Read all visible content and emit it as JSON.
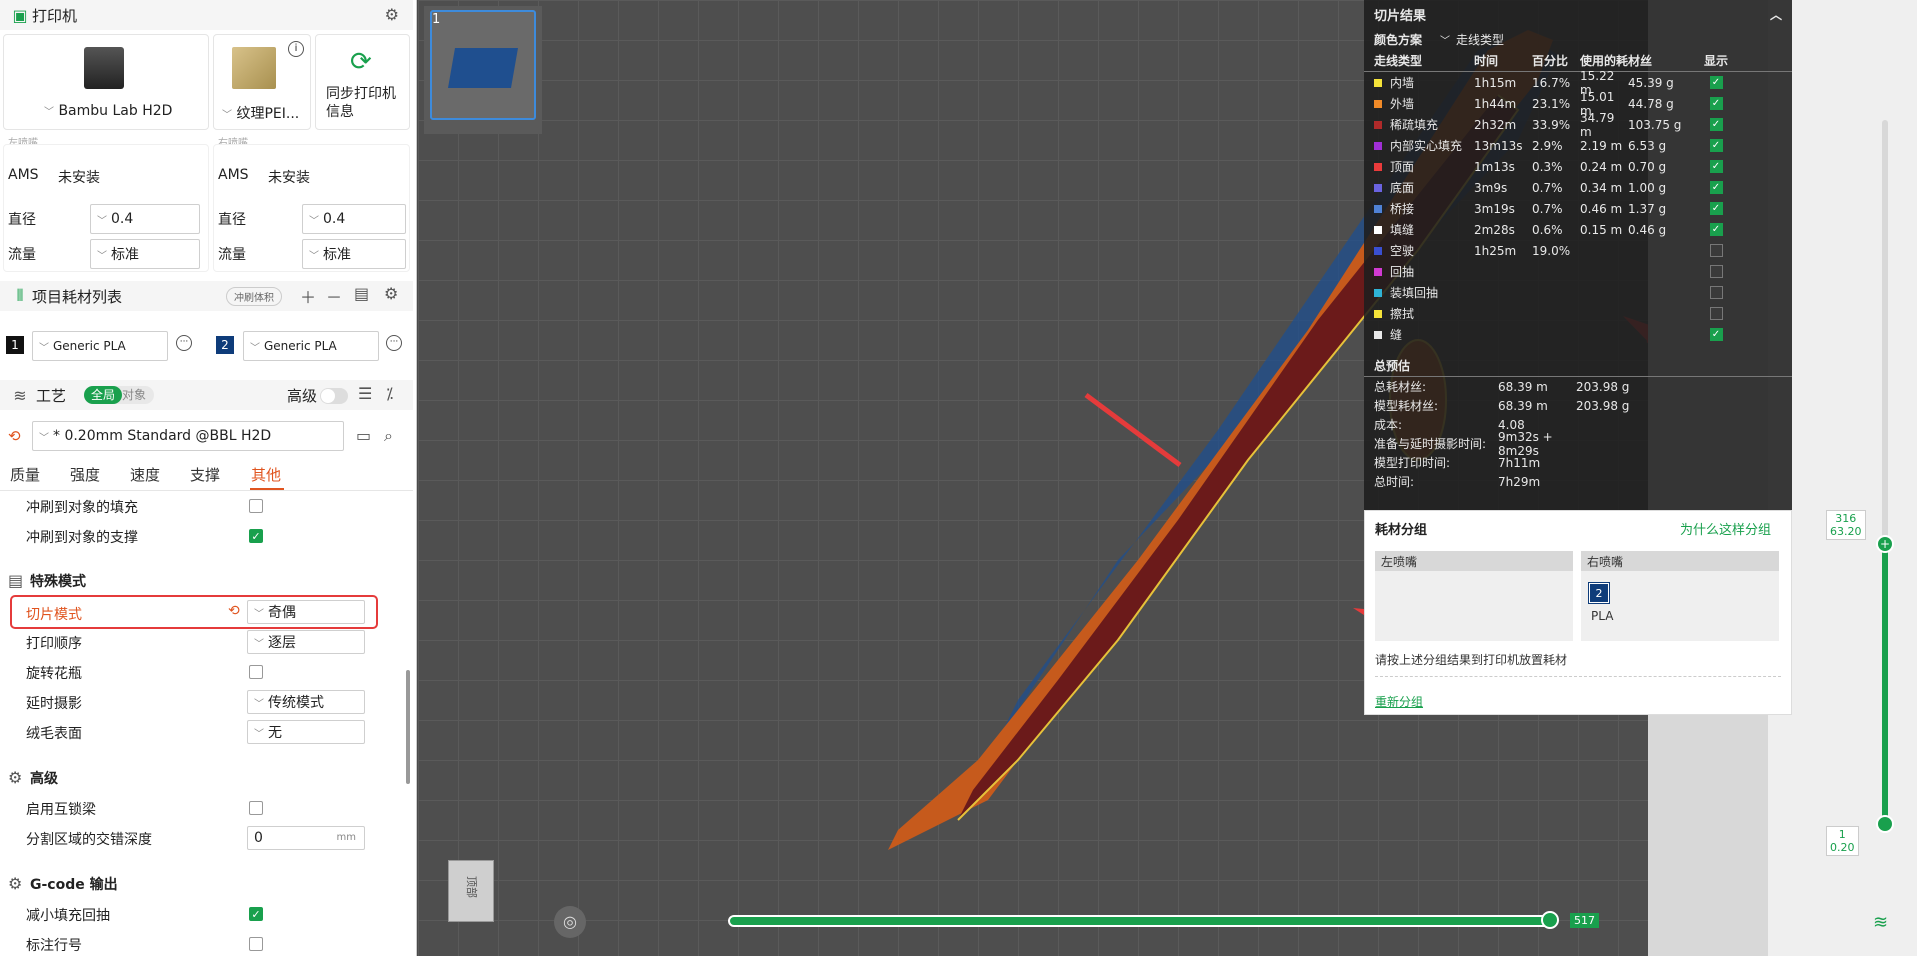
{
  "printer": {
    "title": "打印机",
    "printer_name": "Bambu Lab H2D",
    "plate_name": "纹理PEI...",
    "sync_label": "同步打印机信息",
    "left_nozzle": {
      "title": "左喷嘴",
      "ams_label": "AMS",
      "ams_value": "未安装",
      "diameter_label": "直径",
      "diameter": "0.4",
      "flow_label": "流量",
      "flow": "标准"
    },
    "right_nozzle": {
      "title": "右喷嘴",
      "ams_label": "AMS",
      "ams_value": "未安装",
      "diameter_label": "直径",
      "diameter": "0.4",
      "flow_label": "流量",
      "flow": "标准"
    }
  },
  "filaments": {
    "title": "项目耗材列表",
    "flush_label": "冲刷体积",
    "items": [
      {
        "index": "1",
        "name": "Generic PLA",
        "color": "#111111"
      },
      {
        "index": "2",
        "name": "Generic PLA",
        "color": "#0e3c7a"
      }
    ]
  },
  "process": {
    "title": "工艺",
    "toggle_global": "全局",
    "toggle_object": "对象",
    "advanced_label": "高级",
    "preset": "* 0.20mm Standard @BBL H2D",
    "tabs": [
      "质量",
      "强度",
      "速度",
      "支撑",
      "其他"
    ],
    "active_tab": "其他",
    "settings": {
      "flush_infill": "冲刷到对象的填充",
      "flush_support": "冲刷到对象的支撑",
      "special_mode_header": "特殊模式",
      "slice_mode": "切片模式",
      "slice_mode_value": "奇偶",
      "print_sequence": "打印顺序",
      "print_sequence_value": "逐层",
      "spiral_vase": "旋转花瓶",
      "timelapse": "延时摄影",
      "timelapse_value": "传统模式",
      "fuzzy_skin": "绒毛表面",
      "fuzzy_skin_value": "无",
      "advanced_header": "高级",
      "interlock": "启用互锁梁",
      "interlock_depth": "分割区域的交错深度",
      "interlock_depth_value": "0",
      "interlock_depth_unit": "mm",
      "gcode_header": "G-code 输出",
      "reduce_retract": "减小填充回抽",
      "label_lines": "标注行号"
    }
  },
  "plate": {
    "number": "1"
  },
  "slice_result": {
    "title": "切片结果",
    "scheme_label": "颜色方案",
    "scheme_value": "走线类型",
    "columns": [
      "走线类型",
      "时间",
      "百分比",
      "使用的耗材丝",
      "显示"
    ],
    "rows": [
      {
        "name": "内墙",
        "color": "#f5e33a",
        "time": "1h15m",
        "pct": "16.7%",
        "len": "15.22 m",
        "wt": "45.39 g",
        "show": true,
        "has_box": true
      },
      {
        "name": "外墙",
        "color": "#f08a28",
        "time": "1h44m",
        "pct": "23.1%",
        "len": "15.01 m",
        "wt": "44.78 g",
        "show": true,
        "has_box": true
      },
      {
        "name": "稀疏填充",
        "color": "#b02a2a",
        "time": "2h32m",
        "pct": "33.9%",
        "len": "34.79 m",
        "wt": "103.75 g",
        "show": true,
        "has_box": true
      },
      {
        "name": "内部实心填充",
        "color": "#a02fd6",
        "time": "13m13s",
        "pct": "2.9%",
        "len": "2.19 m",
        "wt": "6.53 g",
        "show": true,
        "has_box": true
      },
      {
        "name": "顶面",
        "color": "#ea3b3b",
        "time": "1m13s",
        "pct": "0.3%",
        "len": "0.24 m",
        "wt": "0.70 g",
        "show": true,
        "has_box": true
      },
      {
        "name": "底面",
        "color": "#6a63e0",
        "time": "3m9s",
        "pct": "0.7%",
        "len": "0.34 m",
        "wt": "1.00 g",
        "show": true,
        "has_box": true
      },
      {
        "name": "桥接",
        "color": "#4f82d6",
        "time": "3m19s",
        "pct": "0.7%",
        "len": "0.46 m",
        "wt": "1.37 g",
        "show": true,
        "has_box": true
      },
      {
        "name": "填缝",
        "color": "#ffffff",
        "time": "2m28s",
        "pct": "0.6%",
        "len": "0.15 m",
        "wt": "0.46 g",
        "show": true,
        "has_box": true
      },
      {
        "name": "空驶",
        "color": "#3a4fd0",
        "time": "1h25m",
        "pct": "19.0%",
        "len": "",
        "wt": "",
        "show": false,
        "has_box": true
      },
      {
        "name": "回抽",
        "color": "#d23ad2",
        "time": "",
        "pct": "",
        "len": "",
        "wt": "",
        "show": false,
        "has_box": true
      },
      {
        "name": "装填回抽",
        "color": "#2fb3d6",
        "time": "",
        "pct": "",
        "len": "",
        "wt": "",
        "show": false,
        "has_box": true
      },
      {
        "name": "擦拭",
        "color": "#f5e33a",
        "time": "",
        "pct": "",
        "len": "",
        "wt": "",
        "show": false,
        "has_box": true
      },
      {
        "name": "缝",
        "color": "#e8e8e8",
        "time": "",
        "pct": "",
        "len": "",
        "wt": "",
        "show": true,
        "has_box": true
      }
    ],
    "estimate": {
      "title": "总预估",
      "rows": [
        {
          "k": "总耗材丝:",
          "v1": "68.39 m",
          "v2": "203.98 g"
        },
        {
          "k": "模型耗材丝:",
          "v1": "68.39 m",
          "v2": "203.98 g"
        },
        {
          "k": "成本:",
          "v1": "4.08",
          "v2": ""
        },
        {
          "k": "准备与延时摄影时间:",
          "v1": "9m32s + 8m29s",
          "v2": ""
        },
        {
          "k": "模型打印时间:",
          "v1": "7h11m",
          "v2": ""
        },
        {
          "k": "总时间:",
          "v1": "7h29m",
          "v2": ""
        }
      ]
    }
  },
  "filament_group": {
    "title": "耗材分组",
    "why_link": "为什么这样分组",
    "left_nozzle": "左喷嘴",
    "right_nozzle": "右喷嘴",
    "right_filament_index": "2",
    "right_filament_type": "PLA",
    "note": "请按上述分组结果到打印机放置耗材",
    "regroup": "重新分组"
  },
  "layer_slider": {
    "top_layer": "316",
    "top_height": "63.20",
    "bottom_layer": "1",
    "bottom_height": "0.20"
  },
  "move_slider": {
    "value": "517"
  },
  "view_cube": {
    "face_label": "顶部"
  }
}
